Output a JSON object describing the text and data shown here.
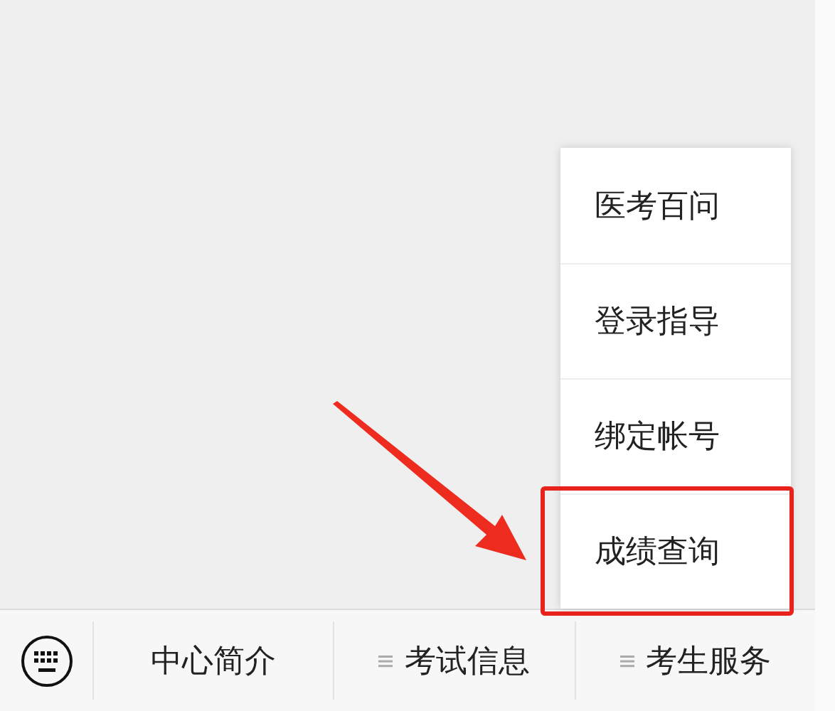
{
  "menu_bar": {
    "items": [
      {
        "label": "中心简介",
        "has_submenu": false
      },
      {
        "label": "考试信息",
        "has_submenu": true
      },
      {
        "label": "考生服务",
        "has_submenu": true
      }
    ]
  },
  "popup_menu": {
    "items": [
      {
        "label": "医考百问",
        "highlighted": false
      },
      {
        "label": "登录指导",
        "highlighted": false
      },
      {
        "label": "绑定帐号",
        "highlighted": false
      },
      {
        "label": "成绩查询",
        "highlighted": true
      }
    ]
  }
}
